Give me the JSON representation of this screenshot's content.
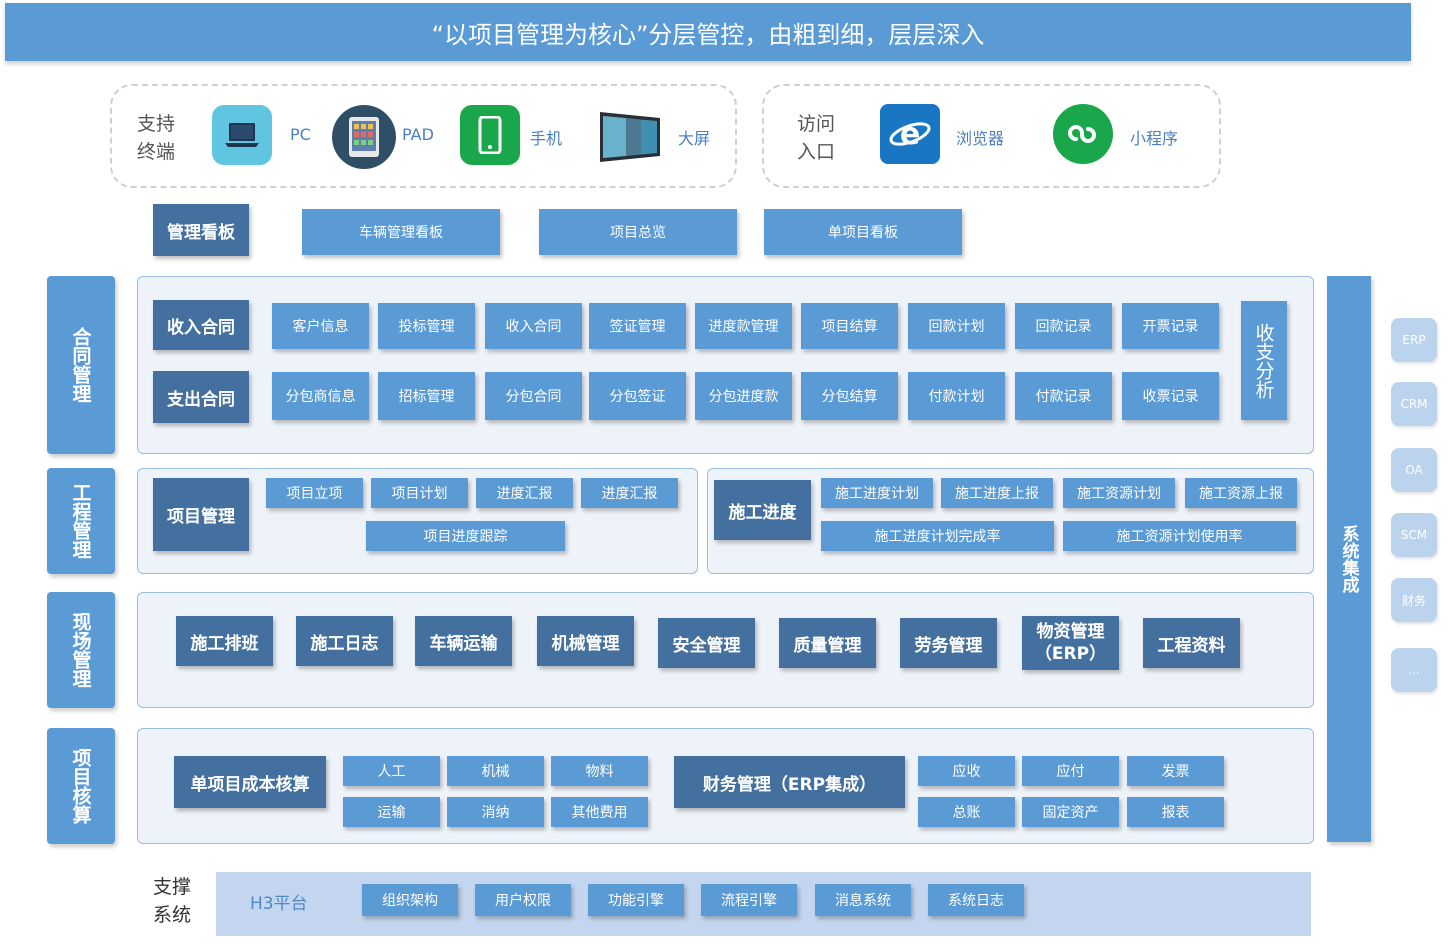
{
  "banner": {
    "title": "“以项目管理为核心”分层管控，由粗到细，层层深入"
  },
  "terminals": {
    "label": "支持\n终端",
    "devices": [
      {
        "label": "PC",
        "icon": "laptop-icon"
      },
      {
        "label": "PAD",
        "icon": "tablet-icon"
      },
      {
        "label": "手机",
        "icon": "phone-icon"
      },
      {
        "label": "大屏",
        "icon": "big-screen-icon"
      }
    ]
  },
  "access": {
    "label": "访问\n入口",
    "entries": [
      {
        "label": "浏览器",
        "icon": "browser-icon"
      },
      {
        "label": "小程序",
        "icon": "mini-program-icon"
      }
    ]
  },
  "dashboard": {
    "title": "管理看板",
    "items": [
      "车辆管理看板",
      "项目总览",
      "单项目看板"
    ]
  },
  "contract": {
    "side": "合同管理",
    "income": {
      "title": "收入合同",
      "items": [
        "客户信息",
        "投标管理",
        "收入合同",
        "签证管理",
        "进度款管理",
        "项目结算",
        "回款计划",
        "回款记录",
        "开票记录"
      ]
    },
    "expense": {
      "title": "支出合同",
      "items": [
        "分包商信息",
        "招标管理",
        "分包合同",
        "分包签证",
        "分包进度款",
        "分包结算",
        "付款计划",
        "付款记录",
        "收票记录"
      ]
    },
    "analysis": "收支分析"
  },
  "engineering": {
    "side": "工程管理",
    "project": {
      "title": "项目管理",
      "items": [
        "项目立项",
        "项目计划",
        "进度汇报",
        "进度汇报"
      ],
      "tracking": "项目进度跟踪"
    },
    "construction": {
      "title": "施工进度",
      "items": [
        "施工进度计划",
        "施工进度上报",
        "施工资源计划",
        "施工资源上报"
      ],
      "rates": [
        "施工进度计划完成率",
        "施工资源计划使用率"
      ]
    }
  },
  "site": {
    "side": "现场管理",
    "items": [
      "施工排班",
      "施工日志",
      "车辆运输",
      "机械管理",
      "安全管理",
      "质量管理",
      "劳务管理",
      "物资管理\n（ERP）",
      "工程资料"
    ]
  },
  "accounting": {
    "side": "项目核算",
    "cost": {
      "title": "单项目成本核算",
      "items": [
        "人工",
        "机械",
        "物料",
        "运输",
        "消纳",
        "其他费用"
      ]
    },
    "finance": {
      "title": "财务管理（ERP集成）",
      "items": [
        "应收",
        "应付",
        "发票",
        "总账",
        "固定资产",
        "报表"
      ]
    }
  },
  "integration": {
    "title": "系统集成",
    "systems": [
      "ERP",
      "CRM",
      "OA",
      "SCM",
      "财务",
      "..."
    ]
  },
  "support": {
    "label": "支撑\n系统",
    "platform": "H3平台",
    "items": [
      "组织架构",
      "用户权限",
      "功能引擎",
      "流程引擎",
      "消息系统",
      "系统日志"
    ]
  },
  "colors": {
    "primary": "#5b9bd5",
    "dark": "#44709f",
    "light": "#bcd3ee",
    "accent_text": "#4a7fc1"
  }
}
